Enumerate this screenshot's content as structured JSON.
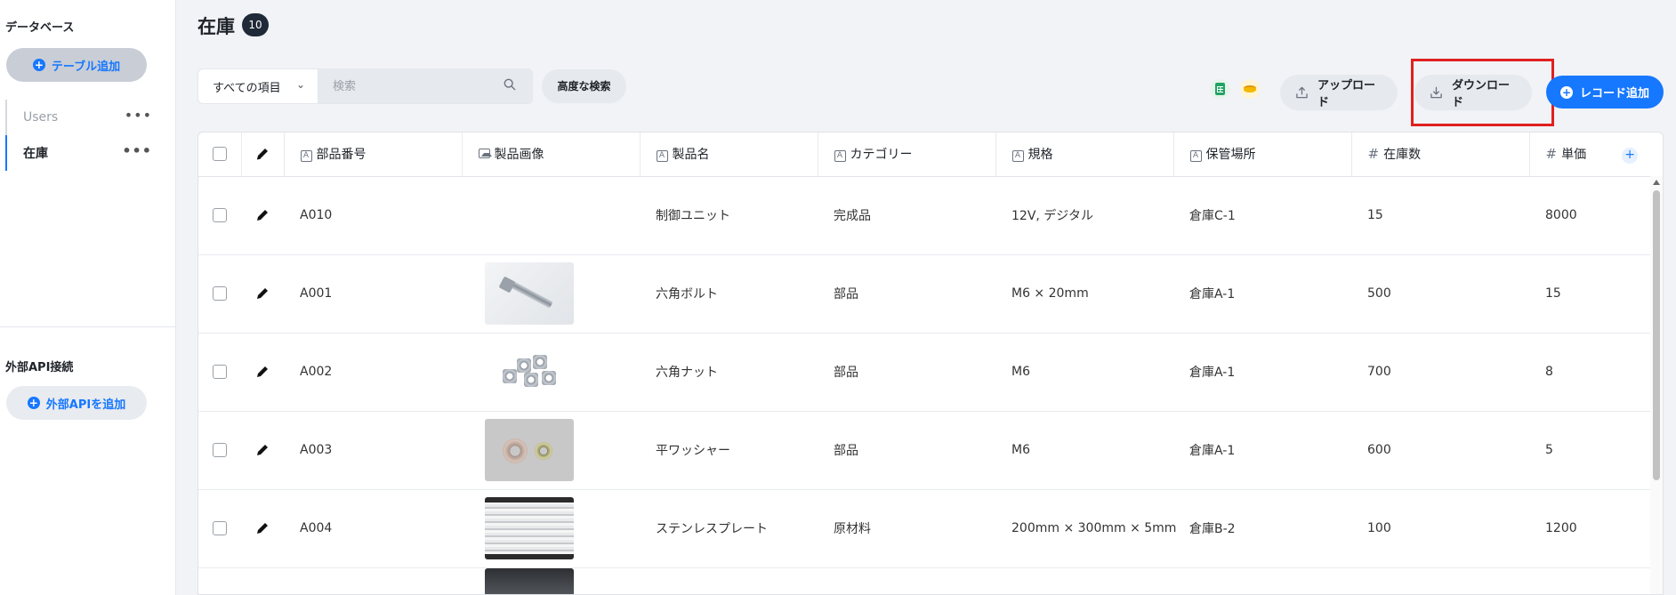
{
  "sidebar": {
    "database_title": "データベース",
    "add_table_label": "テーブル追加",
    "tables": [
      {
        "label": "Users",
        "menu": "•••"
      },
      {
        "label": "在庫",
        "menu": "•••"
      }
    ],
    "api_title": "外部API接続",
    "add_api_label": "外部APIを追加"
  },
  "header": {
    "title": "在庫",
    "count": "10"
  },
  "toolbar": {
    "filter_value": "すべての項目",
    "search_placeholder": "検索",
    "advanced_search_label": "高度な検索",
    "upload_label": "アップロード",
    "download_label": "ダウンロード",
    "add_record_label": "レコード追加"
  },
  "table": {
    "columns": [
      {
        "label": "部品番号",
        "type": "text"
      },
      {
        "label": "製品画像",
        "type": "image"
      },
      {
        "label": "製品名",
        "type": "text"
      },
      {
        "label": "カテゴリー",
        "type": "text"
      },
      {
        "label": "規格",
        "type": "text"
      },
      {
        "label": "保管場所",
        "type": "text"
      },
      {
        "label": "在庫数",
        "type": "number"
      },
      {
        "label": "単価",
        "type": "number"
      }
    ],
    "rows": [
      {
        "part_no": "A010",
        "image": "",
        "name": "制御ユニット",
        "category": "完成品",
        "spec": "12V, デジタル",
        "location": "倉庫C-1",
        "stock": "15",
        "price": "8000"
      },
      {
        "part_no": "A001",
        "image": "bolt",
        "name": "六角ボルト",
        "category": "部品",
        "spec": "M6 × 20mm",
        "location": "倉庫A-1",
        "stock": "500",
        "price": "15"
      },
      {
        "part_no": "A002",
        "image": "nut",
        "name": "六角ナット",
        "category": "部品",
        "spec": "M6",
        "location": "倉庫A-1",
        "stock": "700",
        "price": "8"
      },
      {
        "part_no": "A003",
        "image": "washer",
        "name": "平ワッシャー",
        "category": "部品",
        "spec": "M6",
        "location": "倉庫A-1",
        "stock": "600",
        "price": "5"
      },
      {
        "part_no": "A004",
        "image": "plate",
        "name": "ステンレスプレート",
        "category": "原材料",
        "spec": "200mm × 300mm × 5mm",
        "location": "倉庫B-2",
        "stock": "100",
        "price": "1200"
      }
    ]
  },
  "colors": {
    "accent": "#1677ff",
    "highlight": "#e02020",
    "badge": "#1f2937"
  }
}
